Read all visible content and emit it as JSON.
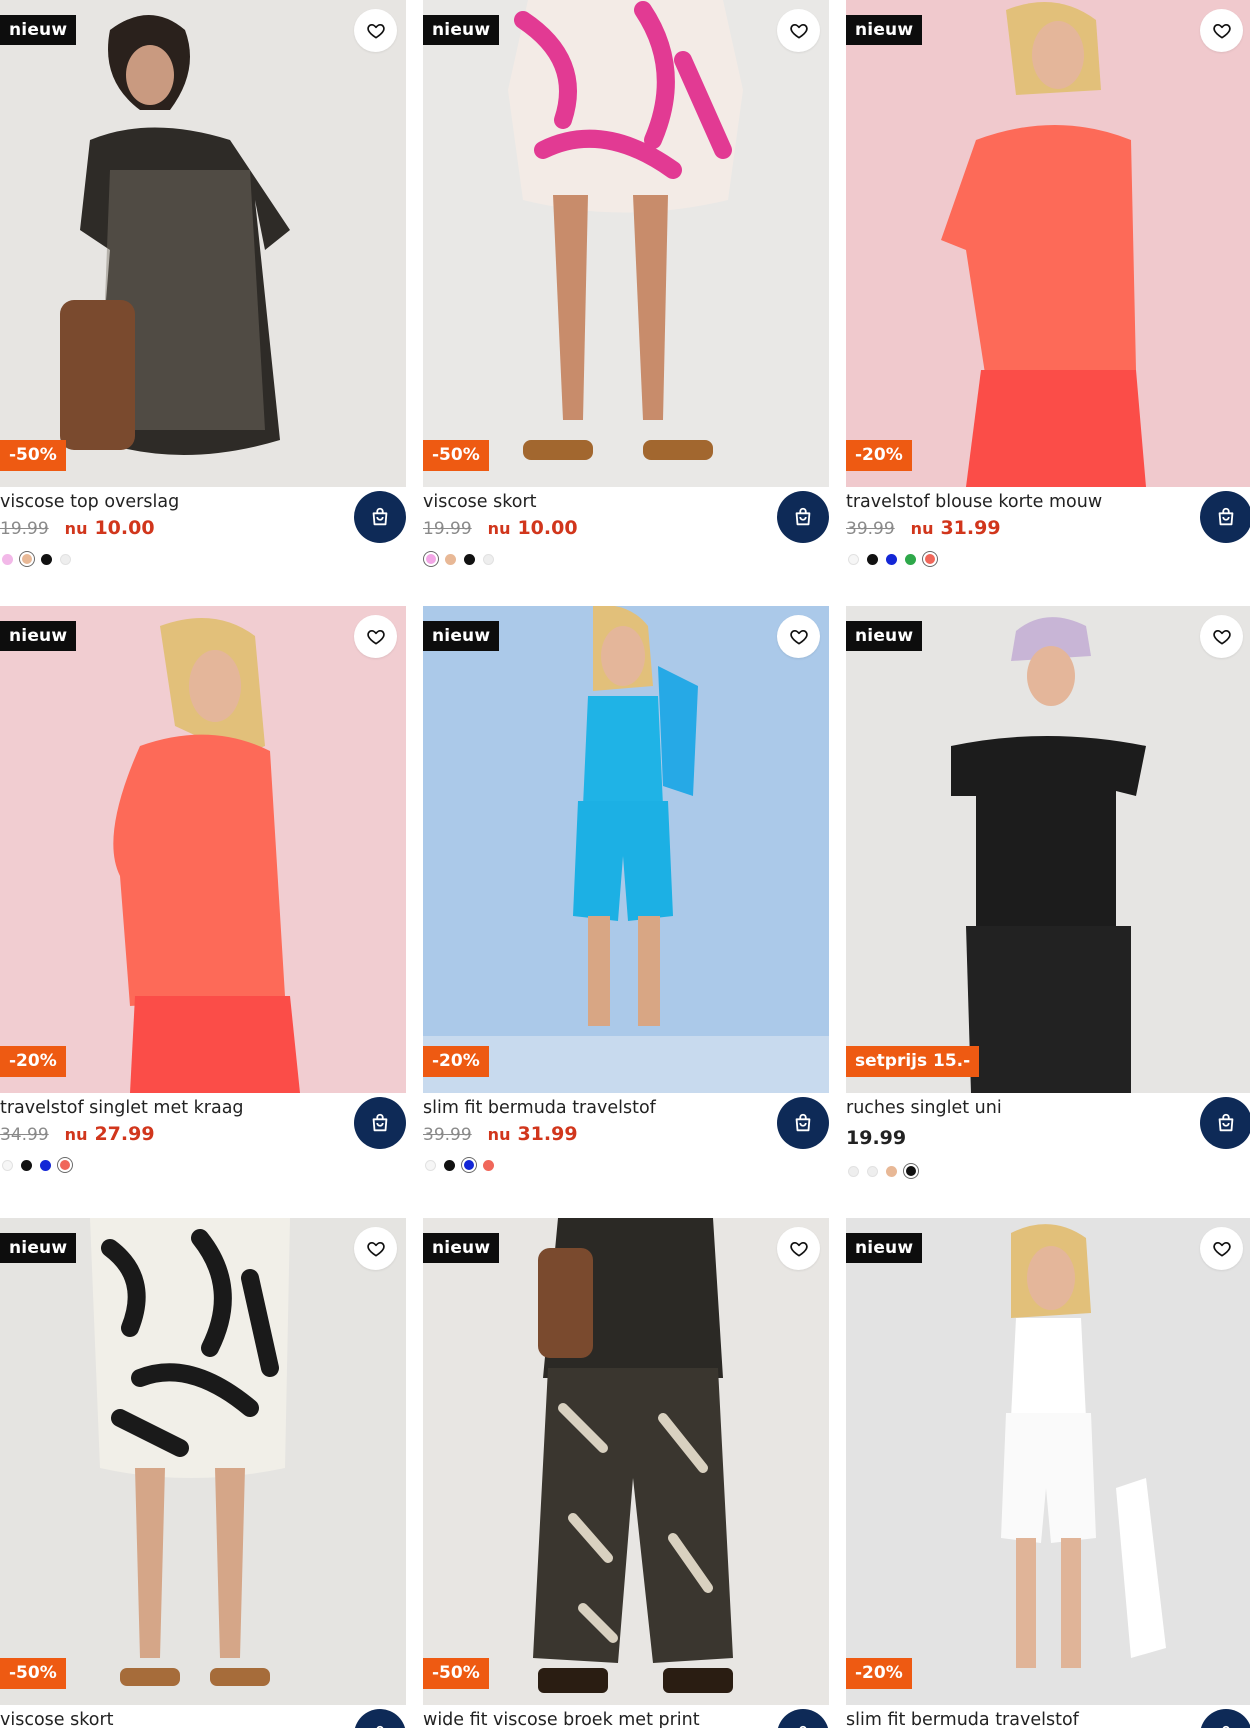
{
  "colors": {
    "new_badge_bg": "#0d0d0d",
    "discount_badge_bg": "#ee5a12",
    "sale_price": "#d1361c",
    "cart_button_bg": "#0e2a57",
    "old_price": "#8a8a8a"
  },
  "products": [
    {
      "new_label": "nieuw",
      "discount": "-50%",
      "title": "viscose top overslag",
      "old_price": "19.99",
      "now_label": "nu",
      "price": "10.00",
      "swatches": [
        {
          "color": "#f2b8e8",
          "selected": false
        },
        {
          "color": "#e8b896",
          "selected": true
        },
        {
          "color": "#111111",
          "selected": false
        },
        {
          "color": "#eeeeee",
          "selected": false
        }
      ]
    },
    {
      "new_label": "nieuw",
      "discount": "-50%",
      "title": "viscose skort",
      "old_price": "19.99",
      "now_label": "nu",
      "price": "10.00",
      "swatches": [
        {
          "color": "#f2a6e6",
          "selected": true
        },
        {
          "color": "#e8b896",
          "selected": false
        },
        {
          "color": "#111111",
          "selected": false
        },
        {
          "color": "#eeeeee",
          "selected": false
        }
      ]
    },
    {
      "new_label": "nieuw",
      "discount": "-20%",
      "title": "travelstof blouse korte mouw",
      "old_price": "39.99",
      "now_label": "nu",
      "price": "31.99",
      "swatches": [
        {
          "color": "#f6f6f6",
          "selected": false
        },
        {
          "color": "#111111",
          "selected": false
        },
        {
          "color": "#1326d6",
          "selected": false
        },
        {
          "color": "#2ea84a",
          "selected": false
        },
        {
          "color": "#f0675a",
          "selected": true
        }
      ]
    },
    {
      "new_label": "nieuw",
      "discount": "-20%",
      "title": "travelstof singlet met kraag",
      "old_price": "34.99",
      "now_label": "nu",
      "price": "27.99",
      "swatches": [
        {
          "color": "#f6f6f6",
          "selected": false
        },
        {
          "color": "#111111",
          "selected": false
        },
        {
          "color": "#1326d6",
          "selected": false
        },
        {
          "color": "#f0675a",
          "selected": true
        }
      ]
    },
    {
      "new_label": "nieuw",
      "discount": "-20%",
      "title": "slim fit bermuda travelstof",
      "old_price": "39.99",
      "now_label": "nu",
      "price": "31.99",
      "swatches": [
        {
          "color": "#f6f6f6",
          "selected": false
        },
        {
          "color": "#111111",
          "selected": false
        },
        {
          "color": "#1326d6",
          "selected": true
        },
        {
          "color": "#f0675a",
          "selected": false
        }
      ]
    },
    {
      "new_label": "nieuw",
      "discount": "setprijs 15.-",
      "title": "ruches singlet uni",
      "old_price": "",
      "now_label": "",
      "price": "19.99",
      "swatches": [
        {
          "color": "#eeeeee",
          "selected": false
        },
        {
          "color": "#eeeeee",
          "selected": false
        },
        {
          "color": "#e8b896",
          "selected": false
        },
        {
          "color": "#111111",
          "selected": true
        }
      ]
    },
    {
      "new_label": "nieuw",
      "discount": "-50%",
      "title": "viscose skort",
      "old_price": "",
      "now_label": "",
      "price": "",
      "swatches": []
    },
    {
      "new_label": "nieuw",
      "discount": "-50%",
      "title": "wide fit viscose broek met print",
      "old_price": "",
      "now_label": "",
      "price": "",
      "swatches": []
    },
    {
      "new_label": "nieuw",
      "discount": "-20%",
      "title": "slim fit bermuda travelstof",
      "old_price": "",
      "now_label": "",
      "price": "",
      "swatches": []
    }
  ]
}
